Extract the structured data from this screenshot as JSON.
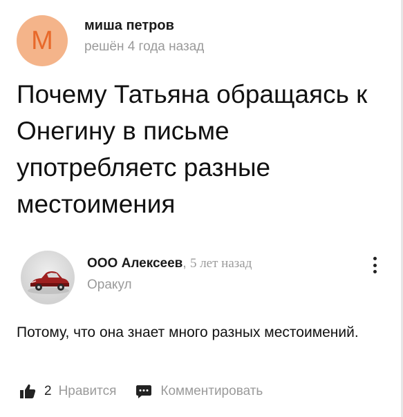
{
  "question": {
    "author": {
      "avatar_letter": "М",
      "name": "миша петров",
      "time": "решён 4 года назад"
    },
    "title": "Почему Татьяна обращаясь к Онегину в письме употребляетс разные местоимения"
  },
  "answer": {
    "author": {
      "name": "ООО Алексеев",
      "separator": ",",
      "time": "5 лет назад",
      "rank": "Оракул"
    },
    "text": "Потому, что она знает много разных местоимений.",
    "likes": {
      "count": "2",
      "label": "Нравится"
    },
    "comment_label": "Комментировать"
  },
  "colors": {
    "avatar_bg": "#f4b48a",
    "avatar_letter": "#e8692a",
    "muted_text": "#9a9a9a",
    "primary_text": "#111111"
  },
  "icons": {
    "like": "thumbs-up-icon",
    "comment": "comment-bubble-icon",
    "more": "vertical-dots-icon"
  }
}
